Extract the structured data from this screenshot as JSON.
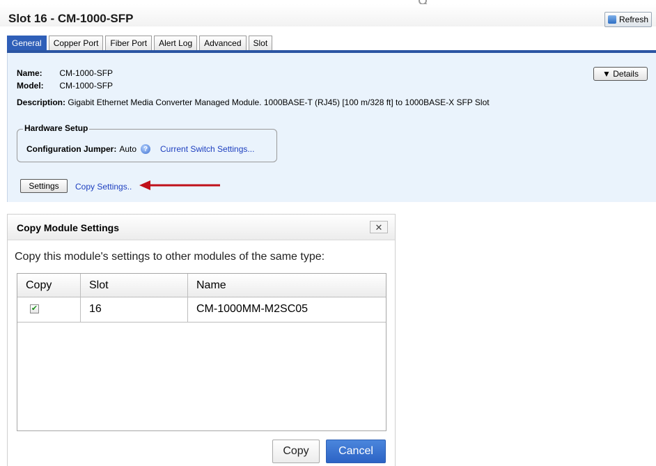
{
  "page": {
    "title": "Slot 16 - CM-1000-SFP",
    "refresh_label": "Refresh",
    "details_label": "▼ Details"
  },
  "tabs": [
    {
      "label": "General",
      "active": true
    },
    {
      "label": "Copper Port"
    },
    {
      "label": "Fiber Port"
    },
    {
      "label": "Alert Log"
    },
    {
      "label": "Advanced"
    },
    {
      "label": "Slot"
    }
  ],
  "general": {
    "name_label": "Name:",
    "name_value": "CM-1000-SFP",
    "model_label": "Model:",
    "model_value": "CM-1000-SFP",
    "description_label": "Description:",
    "description_value": "Gigabit Ethernet Media Converter Managed Module. 1000BASE-T (RJ45) [100 m/328 ft] to 1000BASE-X SFP Slot"
  },
  "hardware_setup": {
    "legend": "Hardware Setup",
    "jumper_label": "Configuration Jumper:",
    "jumper_value": "Auto",
    "switch_settings_link": "Current Switch Settings..."
  },
  "actions": {
    "settings_label": "Settings",
    "copy_settings_link": "Copy Settings.."
  },
  "dialog": {
    "title": "Copy Module Settings",
    "close_label": "✕",
    "message": "Copy this module's settings to other modules of the same type:",
    "columns": [
      "Copy",
      "Slot",
      "Name"
    ],
    "rows": [
      {
        "checked": true,
        "check_mark": "✔",
        "slot": "16",
        "name": "CM-1000MM-M2SC05"
      }
    ],
    "copy_label": "Copy",
    "cancel_label": "Cancel"
  },
  "colors": {
    "tab_active": "#2f5fb8",
    "panel_bg": "#eaf3fc",
    "link": "#1d3fbf",
    "arrow": "#c0101a",
    "cancel_btn": "#2c63c5"
  }
}
